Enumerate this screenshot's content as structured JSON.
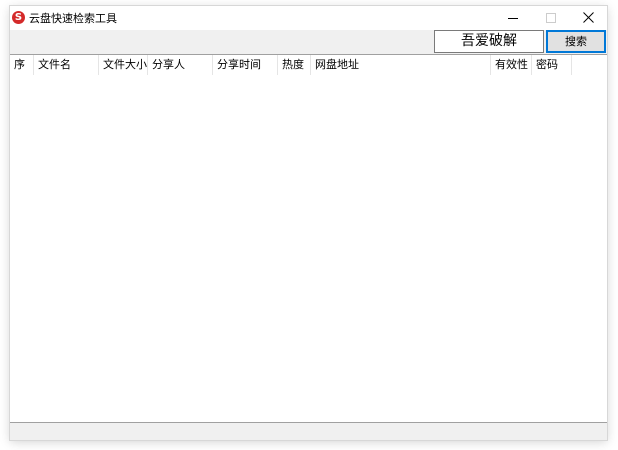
{
  "window": {
    "title": "云盘快速检索工具",
    "app_icon_glyph": "S",
    "app_icon_color": "#d42a2a"
  },
  "toolbar": {
    "password_value": "吾爱破解",
    "search_label": "搜索"
  },
  "list": {
    "columns": [
      "序",
      "文件名",
      "文件大小",
      "分享人",
      "分享时间",
      "热度",
      "网盘地址",
      "有效性",
      "密码"
    ],
    "rows": []
  },
  "icons": {
    "app": "cloud-search-app-icon",
    "minimize": "minimize-icon",
    "maximize": "maximize-icon",
    "close": "close-icon"
  }
}
